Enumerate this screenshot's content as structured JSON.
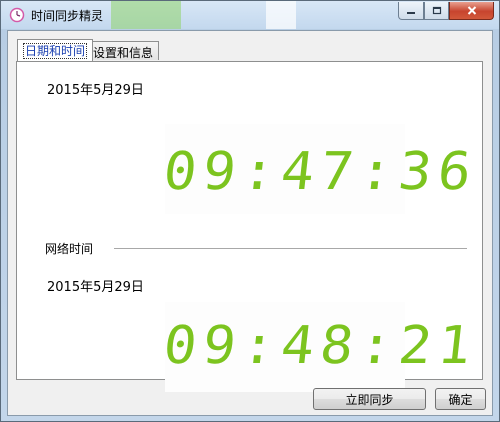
{
  "window": {
    "title": "时间同步精灵",
    "minimize_icon": "minimize-icon",
    "maximize_icon": "maximize-icon",
    "close_icon": "close-icon",
    "app_icon": "clock-icon"
  },
  "tabs": [
    {
      "label": "日期和时间",
      "active": true
    },
    {
      "label": "设置和信息",
      "active": false
    }
  ],
  "local": {
    "date": "2015年5月29日",
    "time": "09:47:36"
  },
  "network": {
    "section_label": "网络时间",
    "date": "2015年5月29日",
    "time": "09:48:21"
  },
  "buttons": {
    "sync_label": "立即同步",
    "ok_label": "确定"
  },
  "colors": {
    "digital": "#7cc41f",
    "active_tab_text": "#1a3fb0"
  }
}
